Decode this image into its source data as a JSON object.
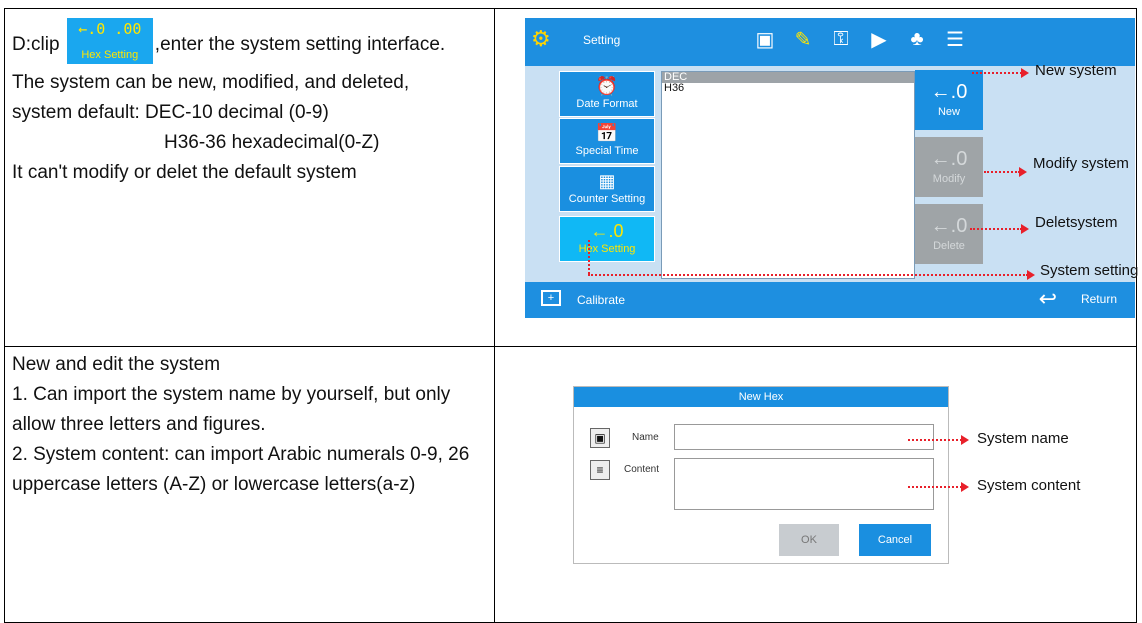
{
  "row1": {
    "line1_prefix": "D:clip",
    "chip_icon": "←.0 .00",
    "chip_label": "Hex Setting",
    "line1_suffix": ",enter the system setting interface.",
    "line2": "The system can be new, modified, and deleted,",
    "line3": "system default: DEC-10 decimal (0-9)",
    "line4": "H36-36 hexadecimal(0-Z)",
    "line5": "It can't modify or delet the default system"
  },
  "screen": {
    "title": "Setting",
    "top_icons": [
      "io-icon",
      "edit-icon",
      "key-icon",
      "speech-icon",
      "users-icon",
      "server-icon"
    ],
    "side_buttons": [
      {
        "label": "Date Format",
        "icon": "⏰"
      },
      {
        "label": "Special Time",
        "icon": "📅"
      },
      {
        "label": "Counter Setting",
        "icon": "▦"
      },
      {
        "label": "Hex Setting",
        "icon": "←.0"
      }
    ],
    "list": [
      "DEC",
      "H36"
    ],
    "right_buttons": [
      {
        "label": "New",
        "icon": "←.0"
      },
      {
        "label": "Modify",
        "icon": "←.0"
      },
      {
        "label": "Delete",
        "icon": "←.0"
      }
    ],
    "calibrate": "Calibrate",
    "return": "Return"
  },
  "annotations": {
    "new": "New system",
    "modify": "Modify system",
    "delete": "Deletsystem",
    "setting": "System setting",
    "name": "System name",
    "content": "System content"
  },
  "row2": {
    "line1": "New and edit the system",
    "line2": "1. Can import the system name by yourself, but only allow three letters and figures.",
    "line3": "2. System content: can import Arabic numerals 0-9, 26 uppercase letters (A-Z) or lowercase letters(a-z)"
  },
  "dialog": {
    "title": "New Hex",
    "name_label": "Name",
    "content_label": "Content",
    "ok": "OK",
    "cancel": "Cancel"
  },
  "colors": {
    "accent": "#1a8fe0",
    "annotation": "#e8202a",
    "highlight": "#ffe600"
  }
}
